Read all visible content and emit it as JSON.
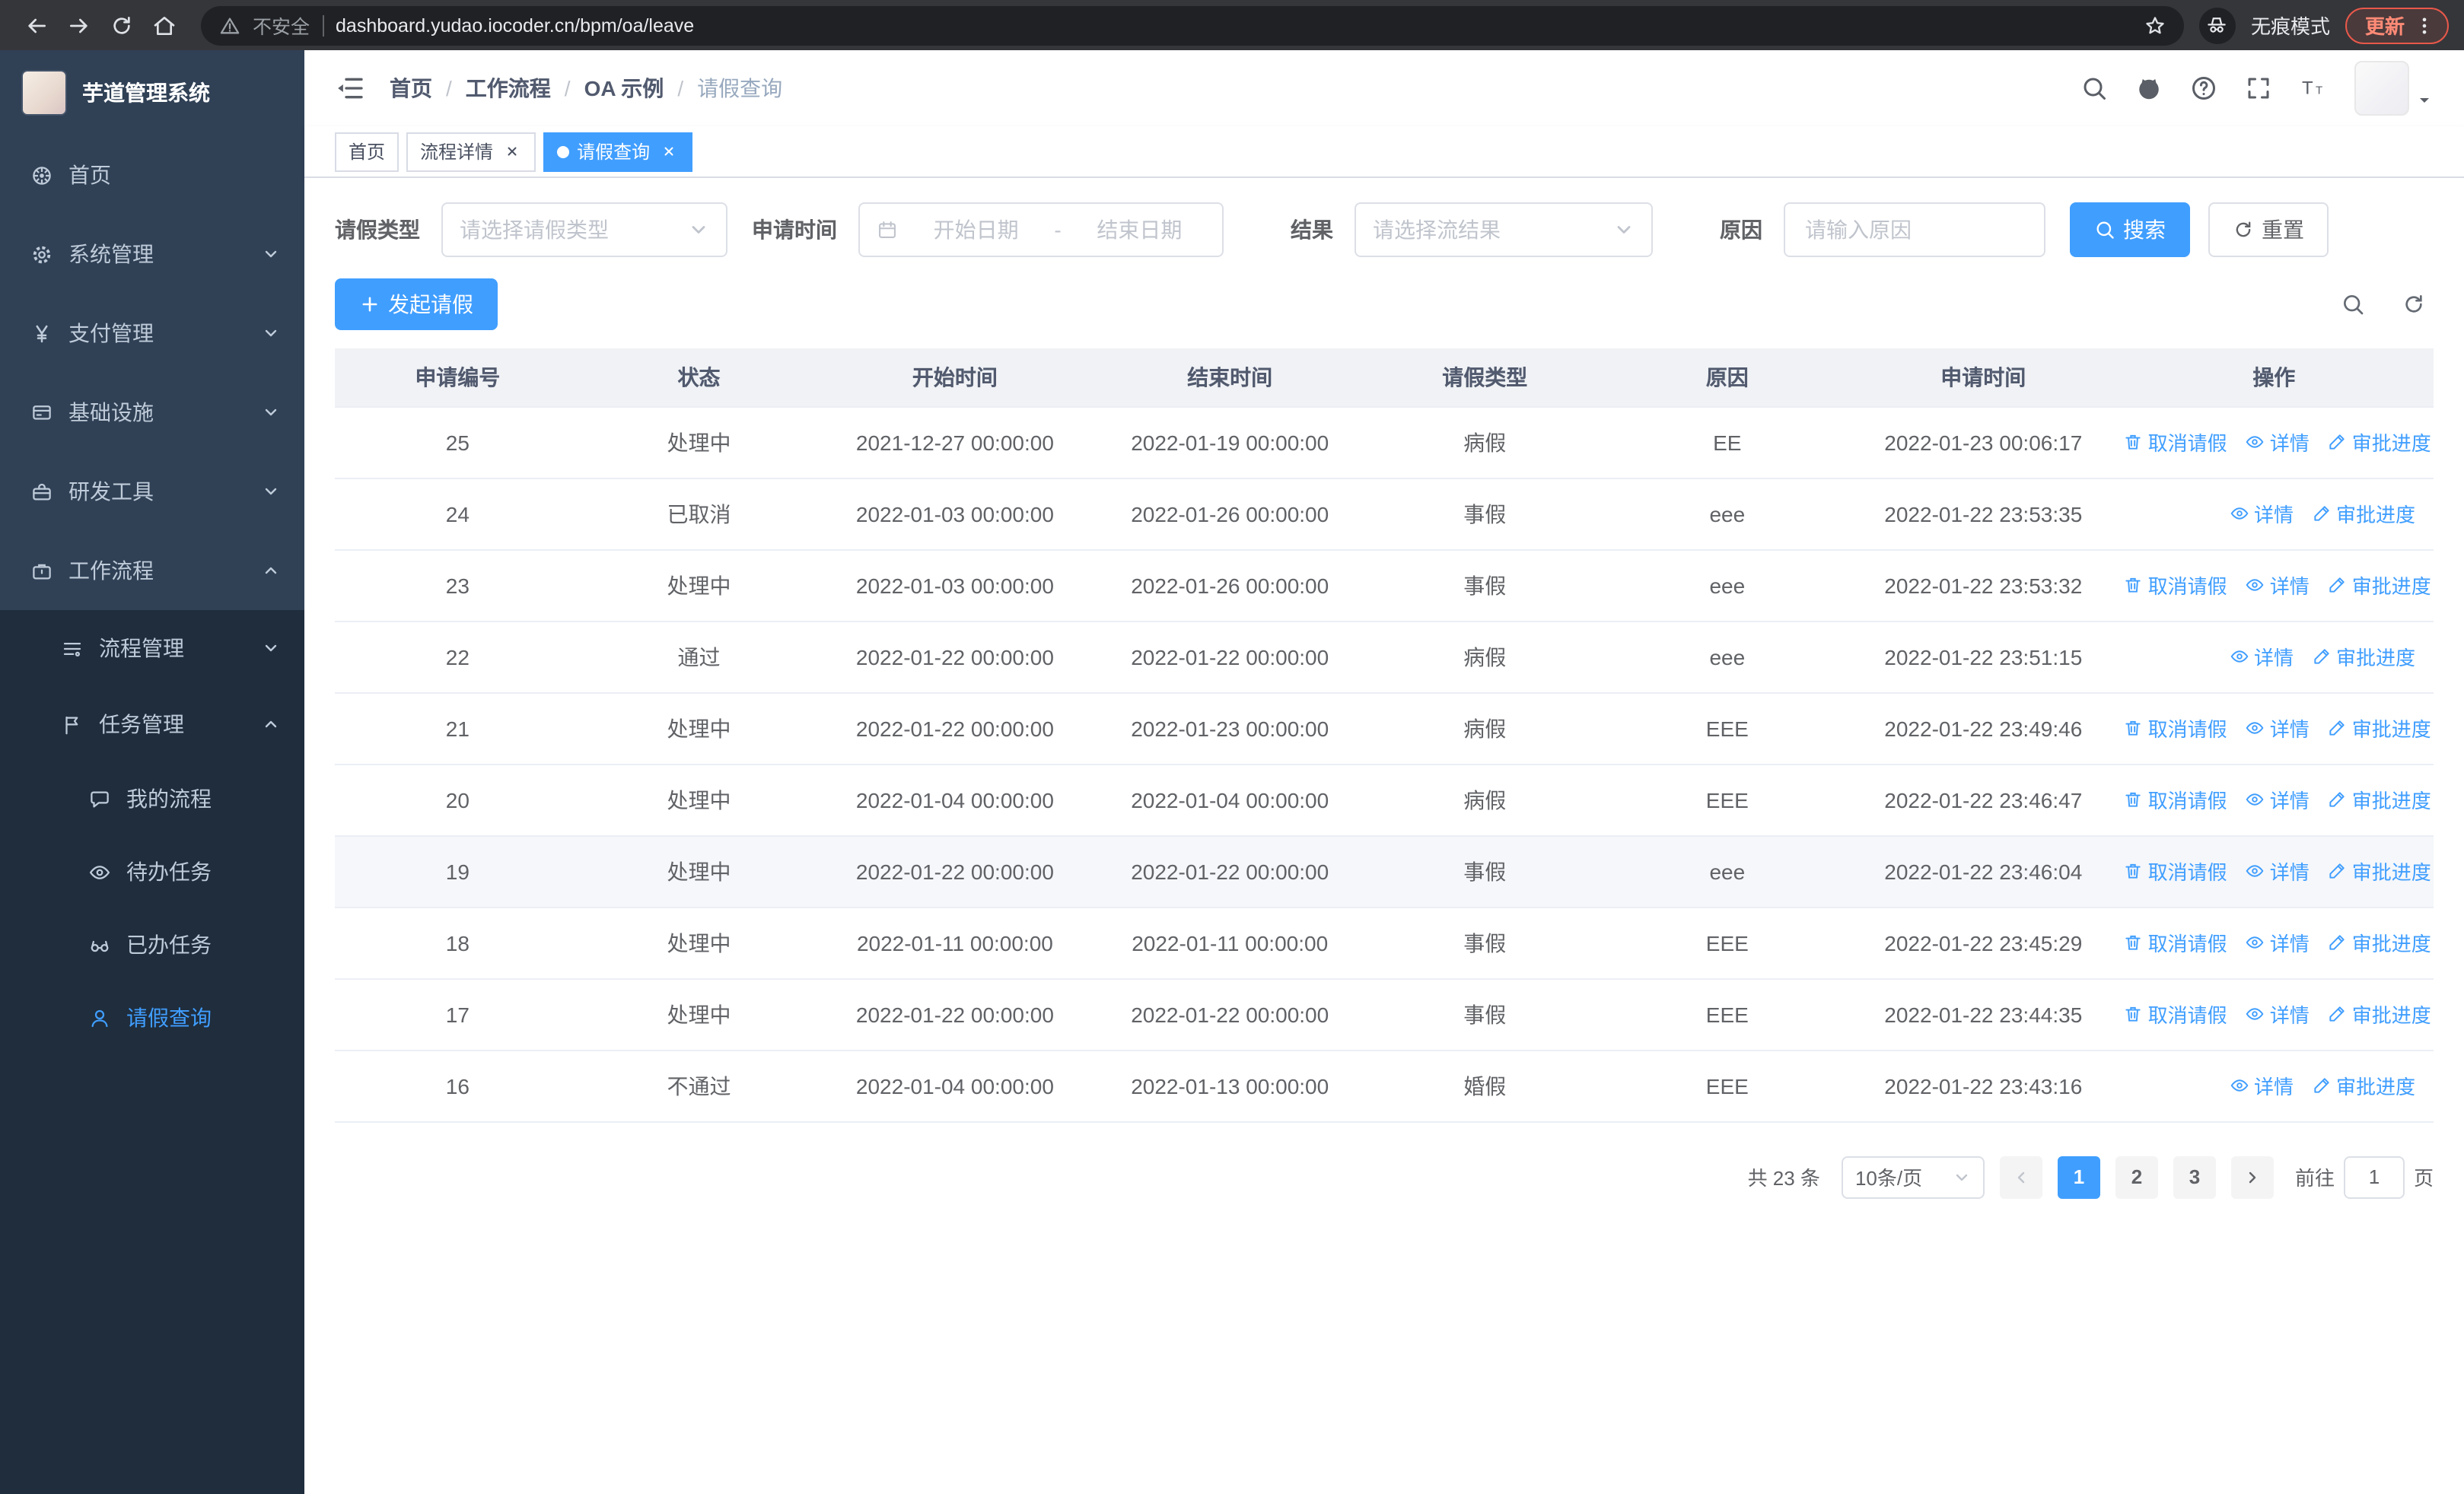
{
  "theme": {
    "primary": "#409eff",
    "sidebar_bg": "#304156",
    "submenu_bg": "#1f2d3d"
  },
  "browser": {
    "security_label": "不安全",
    "url": "dashboard.yudao.iocoder.cn/bpm/oa/leave",
    "incognito_label": "无痕模式",
    "update_label": "更新"
  },
  "sidebar": {
    "logo_title": "芋道管理系统",
    "items": [
      {
        "key": "home",
        "label": "首页",
        "icon": "dashboard",
        "depth": 0
      },
      {
        "key": "system",
        "label": "系统管理",
        "icon": "gear",
        "depth": 0,
        "chevron": "down"
      },
      {
        "key": "payment",
        "label": "支付管理",
        "icon": "yen",
        "depth": 0,
        "chevron": "down"
      },
      {
        "key": "infra",
        "label": "基础设施",
        "icon": "infra",
        "depth": 0,
        "chevron": "down"
      },
      {
        "key": "devtools",
        "label": "研发工具",
        "icon": "tools",
        "depth": 0,
        "chevron": "down"
      },
      {
        "key": "workflow",
        "label": "工作流程",
        "icon": "workflow",
        "depth": 0,
        "chevron": "up"
      },
      {
        "key": "process-mgmt",
        "label": "流程管理",
        "icon": "process",
        "depth": 1,
        "chevron": "down"
      },
      {
        "key": "task-mgmt",
        "label": "任务管理",
        "icon": "task",
        "depth": 1,
        "chevron": "up"
      },
      {
        "key": "my-process",
        "label": "我的流程",
        "icon": "chat",
        "depth": 2
      },
      {
        "key": "todo-task",
        "label": "待办任务",
        "icon": "eye",
        "depth": 2
      },
      {
        "key": "done-task",
        "label": "已办任务",
        "icon": "glasses",
        "depth": 2
      },
      {
        "key": "leave-query",
        "label": "请假查询",
        "icon": "person",
        "depth": 2,
        "active": true
      }
    ]
  },
  "navbar": {
    "breadcrumb": [
      "首页",
      "工作流程",
      "OA 示例",
      "请假查询"
    ]
  },
  "tabs": [
    {
      "label": "首页",
      "active": false,
      "closable": false
    },
    {
      "label": "流程详情",
      "active": false,
      "closable": true
    },
    {
      "label": "请假查询",
      "active": true,
      "closable": true
    }
  ],
  "filters": {
    "leave_type_label": "请假类型",
    "leave_type_placeholder": "请选择请假类型",
    "apply_time_label": "申请时间",
    "start_placeholder": "开始日期",
    "range_separator": "-",
    "end_placeholder": "结束日期",
    "result_label": "结果",
    "result_placeholder": "请选择流结果",
    "reason_label": "原因",
    "reason_placeholder": "请输入原因",
    "search_label": "搜索",
    "reset_label": "重置"
  },
  "toolbar": {
    "create_label": "发起请假"
  },
  "table": {
    "columns": [
      "申请编号",
      "状态",
      "开始时间",
      "结束时间",
      "请假类型",
      "原因",
      "申请时间",
      "操作"
    ],
    "action_labels": {
      "cancel": "取消请假",
      "detail": "详情",
      "progress": "审批进度"
    },
    "rows": [
      {
        "id": "25",
        "status": "处理中",
        "start": "2021-12-27 00:00:00",
        "end": "2022-01-19 00:00:00",
        "type": "病假",
        "reason": "EE",
        "apply": "2022-01-23 00:06:17",
        "actions": [
          "cancel",
          "detail",
          "progress"
        ]
      },
      {
        "id": "24",
        "status": "已取消",
        "start": "2022-01-03 00:00:00",
        "end": "2022-01-26 00:00:00",
        "type": "事假",
        "reason": "eee",
        "apply": "2022-01-22 23:53:35",
        "actions": [
          "detail",
          "progress"
        ]
      },
      {
        "id": "23",
        "status": "处理中",
        "start": "2022-01-03 00:00:00",
        "end": "2022-01-26 00:00:00",
        "type": "事假",
        "reason": "eee",
        "apply": "2022-01-22 23:53:32",
        "actions": [
          "cancel",
          "detail",
          "progress"
        ]
      },
      {
        "id": "22",
        "status": "通过",
        "start": "2022-01-22 00:00:00",
        "end": "2022-01-22 00:00:00",
        "type": "病假",
        "reason": "eee",
        "apply": "2022-01-22 23:51:15",
        "actions": [
          "detail",
          "progress"
        ]
      },
      {
        "id": "21",
        "status": "处理中",
        "start": "2022-01-22 00:00:00",
        "end": "2022-01-23 00:00:00",
        "type": "病假",
        "reason": "EEE",
        "apply": "2022-01-22 23:49:46",
        "actions": [
          "cancel",
          "detail",
          "progress"
        ]
      },
      {
        "id": "20",
        "status": "处理中",
        "start": "2022-01-04 00:00:00",
        "end": "2022-01-04 00:00:00",
        "type": "病假",
        "reason": "EEE",
        "apply": "2022-01-22 23:46:47",
        "actions": [
          "cancel",
          "detail",
          "progress"
        ]
      },
      {
        "id": "19",
        "status": "处理中",
        "start": "2022-01-22 00:00:00",
        "end": "2022-01-22 00:00:00",
        "type": "事假",
        "reason": "eee",
        "apply": "2022-01-22 23:46:04",
        "actions": [
          "cancel",
          "detail",
          "progress"
        ],
        "highlighted": true
      },
      {
        "id": "18",
        "status": "处理中",
        "start": "2022-01-11 00:00:00",
        "end": "2022-01-11 00:00:00",
        "type": "事假",
        "reason": "EEE",
        "apply": "2022-01-22 23:45:29",
        "actions": [
          "cancel",
          "detail",
          "progress"
        ]
      },
      {
        "id": "17",
        "status": "处理中",
        "start": "2022-01-22 00:00:00",
        "end": "2022-01-22 00:00:00",
        "type": "事假",
        "reason": "EEE",
        "apply": "2022-01-22 23:44:35",
        "actions": [
          "cancel",
          "detail",
          "progress"
        ]
      },
      {
        "id": "16",
        "status": "不通过",
        "start": "2022-01-04 00:00:00",
        "end": "2022-01-13 00:00:00",
        "type": "婚假",
        "reason": "EEE",
        "apply": "2022-01-22 23:43:16",
        "actions": [
          "detail",
          "progress"
        ]
      }
    ]
  },
  "pagination": {
    "total_label": "共 23 条",
    "page_size_label": "10条/页",
    "pages": [
      "1",
      "2",
      "3"
    ],
    "active_page": "1",
    "goto_label": "前往",
    "goto_value": "1",
    "goto_suffix": "页"
  }
}
